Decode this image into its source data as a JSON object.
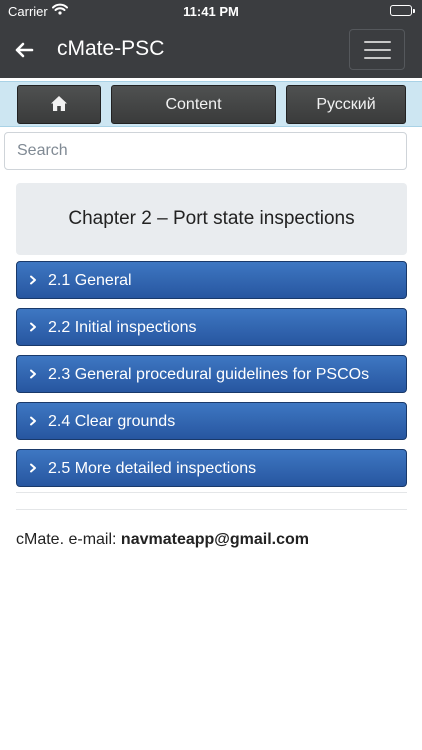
{
  "status_bar": {
    "carrier": "Carrier",
    "time": "11:41 PM"
  },
  "app_bar": {
    "title": "cMate-PSC"
  },
  "toolbar": {
    "content_label": "Content",
    "language_label": "Русский"
  },
  "search": {
    "placeholder": "Search",
    "value": ""
  },
  "chapter": {
    "title": "Chapter 2 – Port state inspections"
  },
  "sections": [
    {
      "label": "2.1 General"
    },
    {
      "label": "2.2 Initial inspections"
    },
    {
      "label": "2.3 General procedural guidelines for PSCOs"
    },
    {
      "label": "2.4 Clear grounds"
    },
    {
      "label": "2.5 More detailed inspections"
    }
  ],
  "footer": {
    "prefix": "cMate. e-mail: ",
    "email": "navmateapp@gmail.com"
  },
  "icons": [
    "wifi-icon",
    "battery-icon",
    "back-arrow-icon",
    "hamburger-menu-icon",
    "home-icon",
    "chevron-right-icon"
  ],
  "colors": {
    "app_bar": "#3b3d40",
    "strip": "#cde6f2",
    "section_button": "#2f64b0",
    "chapter_box": "#e9ecef"
  }
}
